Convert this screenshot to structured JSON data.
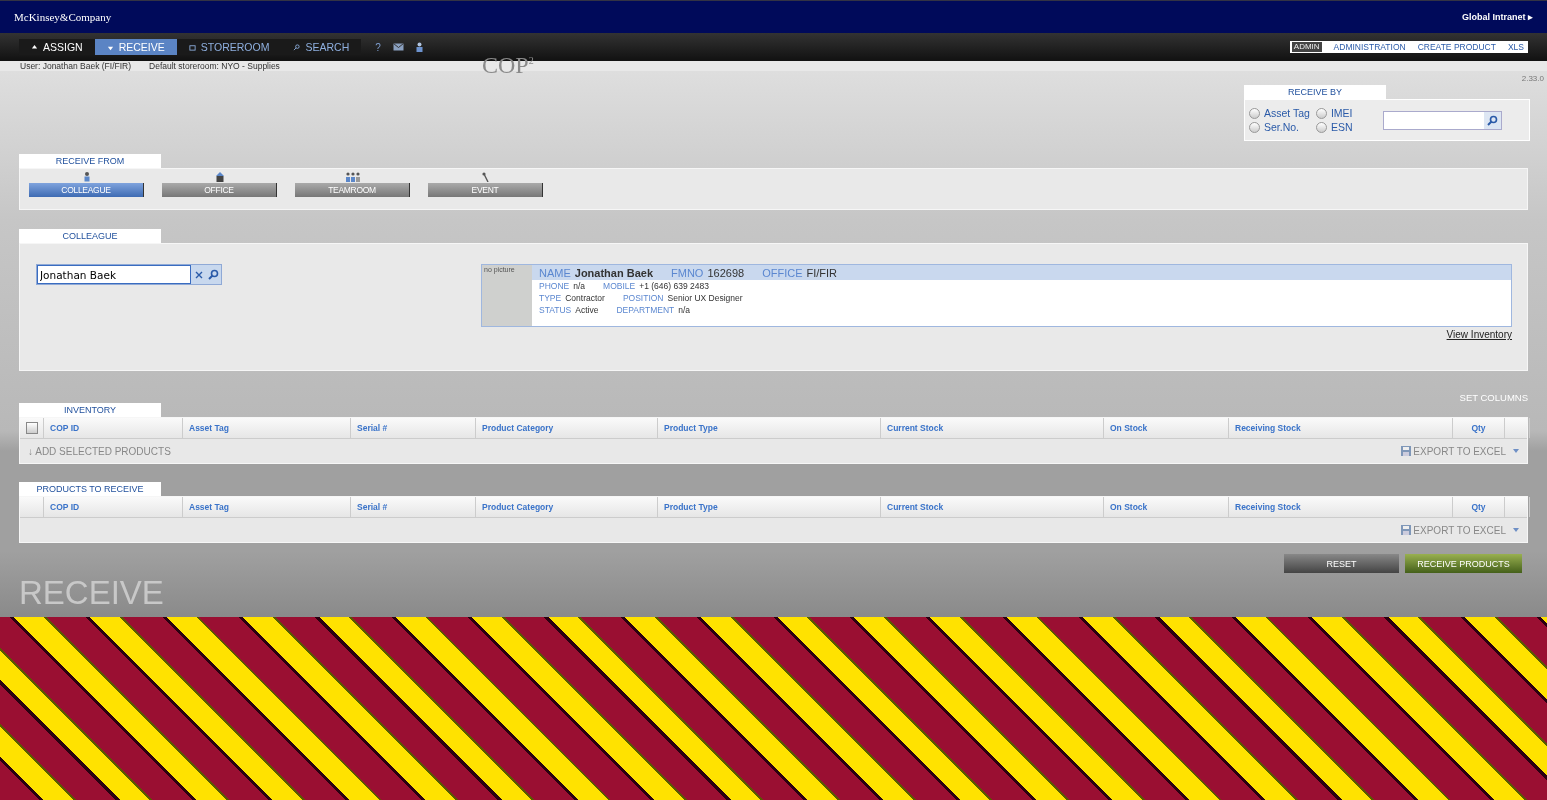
{
  "header": {
    "logo": "McKinsey&Company",
    "global_link": "Global Intranet ▸"
  },
  "nav": {
    "tabs": [
      {
        "label": "ASSIGN",
        "selected": false,
        "kind": "up"
      },
      {
        "label": "RECEIVE",
        "selected": true,
        "kind": "down"
      },
      {
        "label": "STOREROOM",
        "selected": false,
        "kind": "box"
      },
      {
        "label": "SEARCH",
        "selected": false,
        "kind": "search"
      }
    ],
    "help": "?",
    "admin_badge": "ADMIN",
    "admin_links": [
      "ADMINISTRATION",
      "CREATE  PRODUCT",
      "XLS"
    ]
  },
  "user_line": {
    "user": "User: Jonathan Baek (FI/FIR)",
    "storeroom": "Default storeroom: NYO - Supplies"
  },
  "app_logo": "COP$^{2}$",
  "version": "2.33.0",
  "receive_by": {
    "title": "RECEIVE  BY",
    "options": [
      {
        "label": "Asset Tag",
        "selected": false
      },
      {
        "label": "IMEI",
        "selected": false
      },
      {
        "label": "Ser.No.",
        "selected": false
      },
      {
        "label": "ESN",
        "selected": false
      }
    ]
  },
  "receive_from": {
    "title": "RECEIVE  FROM",
    "sources": [
      {
        "label": "COLLEAGUE",
        "selected": true,
        "kind": "person"
      },
      {
        "label": "OFFICE",
        "selected": false,
        "kind": "building"
      },
      {
        "label": "TEAMROOM",
        "selected": false,
        "kind": "group"
      },
      {
        "label": "EVENT",
        "selected": false,
        "kind": "pin"
      }
    ]
  },
  "colleague": {
    "title": "COLLEAGUE",
    "search_value": "Jonathan Baek",
    "photo_placeholder": "no picture",
    "card_rows": [
      [
        {
          "label": "NAME",
          "value": "Jonathan Baek"
        },
        {
          "label": "FMNO",
          "value": "162698"
        },
        {
          "label": "OFFICE",
          "value": "FI/FIR"
        }
      ],
      [
        {
          "label": "PHONE",
          "value": "n/a"
        },
        {
          "label": "MOBILE",
          "value": "+1 (646) 639 2483"
        }
      ],
      [
        {
          "label": "TYPE",
          "value": "Contractor"
        },
        {
          "label": "POSITION",
          "value": "Senior UX Designer"
        }
      ],
      [
        {
          "label": "STATUS",
          "value": "Active"
        },
        {
          "label": "DEPARTMENT",
          "value": "n/a"
        }
      ]
    ],
    "view_inventory": "View Inventory"
  },
  "set_columns": "SET COLUMNS",
  "inventory": {
    "title": "INVENTORY",
    "select_all": {
      "checked": false
    },
    "columns": [
      "COP ID",
      "Asset Tag",
      "Serial #",
      "Product Category",
      "Product Type",
      "Current Stock",
      "On Stock",
      "Receiving Stock",
      "Qty"
    ],
    "add_selected": "↓ ADD SELECTED PRODUCTS",
    "export": "EXPORT TO EXCEL"
  },
  "products_to_receive": {
    "title": "PRODUCTS  TO  RECEIVE",
    "columns": [
      "COP ID",
      "Asset Tag",
      "Serial #",
      "Product Category",
      "Product Type",
      "Current Stock",
      "On Stock",
      "Receiving Stock",
      "Qty"
    ],
    "export": "EXPORT TO EXCEL"
  },
  "actions": [
    "RESET",
    "RECEIVE PRODUCTS"
  ],
  "page_title": "RECEIVE"
}
